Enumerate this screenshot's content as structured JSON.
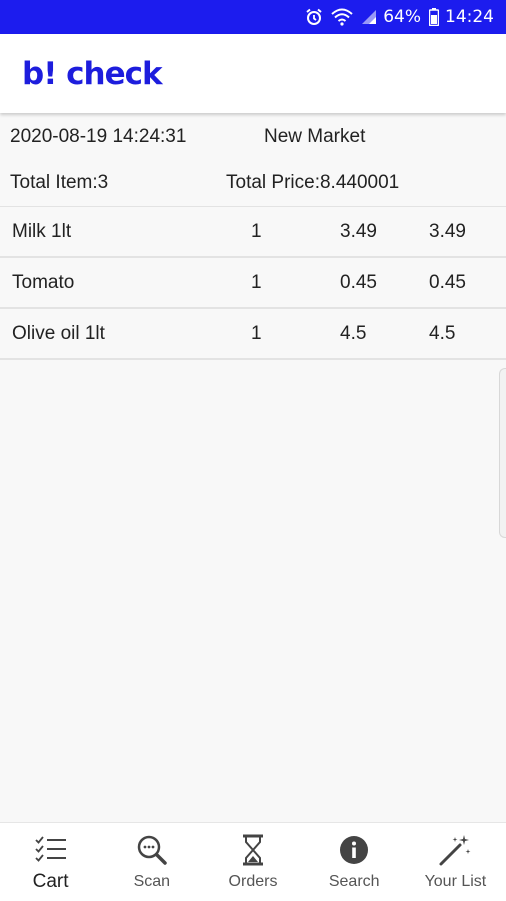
{
  "status_bar": {
    "battery": "64%",
    "time": "14:24"
  },
  "header": {
    "logo": "b! check"
  },
  "order": {
    "datetime": "2020-08-19 14:24:31",
    "market": "New Market",
    "total_items": "Total Item:3",
    "total_price": "Total Price:8.440001"
  },
  "items": [
    {
      "name": "Milk 1lt",
      "qty": "1",
      "price": "3.49",
      "total": "3.49"
    },
    {
      "name": "Tomato",
      "qty": "1",
      "price": "0.45",
      "total": "0.45"
    },
    {
      "name": "Olive oil 1lt",
      "qty": "1",
      "price": "4.5",
      "total": "4.5"
    }
  ],
  "nav": [
    {
      "label": "Cart",
      "icon": "checklist-icon"
    },
    {
      "label": "Scan",
      "icon": "magnifier-icon"
    },
    {
      "label": "Orders",
      "icon": "hourglass-icon"
    },
    {
      "label": "Search",
      "icon": "info-icon"
    },
    {
      "label": "Your List",
      "icon": "magic-wand-icon"
    }
  ],
  "colors": {
    "status_bar": "#1c1cee",
    "logo": "#1d1ddd"
  }
}
